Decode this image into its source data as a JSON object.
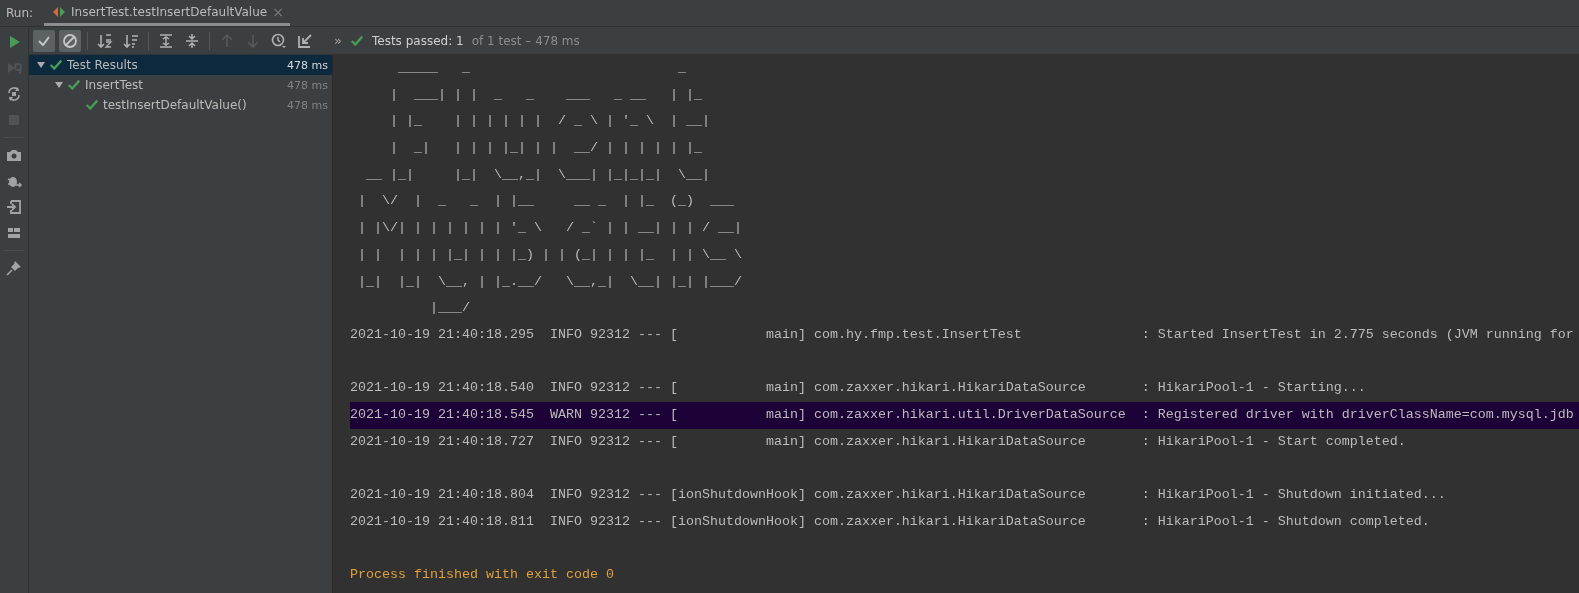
{
  "run_bar": {
    "label": "Run:",
    "tab": {
      "title": "InsertTest.testInsertDefaultValue",
      "close": "×",
      "selected": true
    }
  },
  "side_tools": [
    {
      "kind": "run",
      "disabled": false
    },
    {
      "kind": "rerun-failed",
      "disabled": true
    },
    {
      "kind": "toggle-auto",
      "disabled": false
    },
    {
      "kind": "stop",
      "disabled": true
    },
    {
      "kind": "camera",
      "disabled": false
    },
    {
      "kind": "debug-export",
      "disabled": false
    },
    {
      "kind": "exit",
      "disabled": false
    },
    {
      "kind": "layout",
      "disabled": false
    },
    {
      "kind": "pin",
      "disabled": false
    }
  ],
  "toolbar": {
    "filters": [
      {
        "kind": "show-passed",
        "selected": true
      },
      {
        "kind": "show-ignored",
        "selected": true
      }
    ],
    "tool_groups": [
      [
        {
          "kind": "sort-alpha",
          "disabled": false
        },
        {
          "kind": "sort-duration",
          "disabled": false
        }
      ],
      [
        {
          "kind": "expand-all",
          "disabled": false
        },
        {
          "kind": "collapse-all",
          "disabled": false
        }
      ],
      [
        {
          "kind": "previous",
          "disabled": true
        },
        {
          "kind": "next",
          "disabled": true
        },
        {
          "kind": "history",
          "disabled": false
        },
        {
          "kind": "import",
          "disabled": false
        }
      ]
    ],
    "overflow": "»",
    "status": {
      "summary": "Tests passed: 1",
      "detail": "of 1 test – 478 ms"
    }
  },
  "tree": [
    {
      "label": "Test Results",
      "duration": "478 ms",
      "passed": true,
      "selected": true,
      "expanded": true,
      "children": [
        {
          "label": "InsertTest",
          "duration": "478 ms",
          "passed": true,
          "selected": false,
          "expanded": true,
          "children": [
            {
              "label": "testInsertDefaultValue()",
              "duration": "478 ms",
              "passed": true,
              "selected": false
            }
          ]
        }
      ]
    }
  ],
  "console": {
    "banner": [
      "      _____   _                          _",
      "     |  ___| | |  _   _    ___   _ __   | |_",
      "     | |_    | | | | | |  / _ \\ | '_ \\  | __|",
      "     |  _|   | | | |_| | |  __/ | | | | | |_",
      "  __ |_|     |_|  \\__,_|  \\___| |_|_|_|  \\__|",
      " |  \\/  |  _   _  | |__     __ _  | |_  (_)  ___",
      " | |\\/| | | | | | | '_ \\   / _` | | __| | | / __|",
      " | |  | | | |_| | | |_) | | (_| | | |_  | | \\__ \\",
      " |_|  |_|  \\__, | |_.__/   \\__,_|  \\__| |_| |___/",
      "          |___/"
    ],
    "log_groups": [
      [
        {
          "text": "2021-10-19 21:40:18.295  INFO 92312 --- [           main] com.hy.fmp.test.InsertTest               : Started InsertTest in 2.775 seconds (JVM running for",
          "highlighted": false
        }
      ],
      [
        {
          "text": "2021-10-19 21:40:18.540  INFO 92312 --- [           main] com.zaxxer.hikari.HikariDataSource       : HikariPool-1 - Starting...",
          "highlighted": false
        },
        {
          "text": "2021-10-19 21:40:18.545  WARN 92312 --- [           main] com.zaxxer.hikari.util.DriverDataSource  : Registered driver with driverClassName=com.mysql.jdb",
          "highlighted": true
        },
        {
          "text": "2021-10-19 21:40:18.727  INFO 92312 --- [           main] com.zaxxer.hikari.HikariDataSource       : HikariPool-1 - Start completed.",
          "highlighted": false
        }
      ],
      [
        {
          "text": "2021-10-19 21:40:18.804  INFO 92312 --- [ionShutdownHook] com.zaxxer.hikari.HikariDataSource       : HikariPool-1 - Shutdown initiated...",
          "highlighted": false
        },
        {
          "text": "2021-10-19 21:40:18.811  INFO 92312 --- [ionShutdownHook] com.zaxxer.hikari.HikariDataSource       : HikariPool-1 - Shutdown completed.",
          "highlighted": false
        }
      ]
    ],
    "exit_message": "Process finished with exit code 0"
  }
}
